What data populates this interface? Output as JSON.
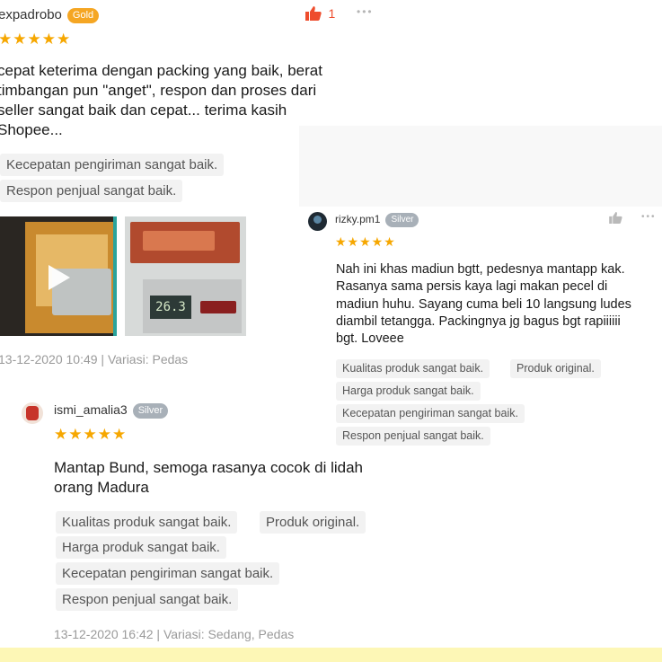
{
  "review1": {
    "username": "expadrobo",
    "badge": "Gold",
    "likes": "1",
    "more": "•••",
    "stars": "★★★★★",
    "text_lines": [
      "cepat keterima dengan packing yang baik, berat",
      "timbangan pun \"anget\", respon dan proses dari",
      "seller sangat baik dan cepat... terima kasih",
      "Shopee..."
    ],
    "tags": [
      "Kecepatan pengiriman sangat baik.",
      "Respon penjual sangat baik."
    ],
    "scale_display": "26.3",
    "meta": "13-12-2020 10:49 | Variasi: Pedas"
  },
  "review2": {
    "username": "rizky.pm1",
    "badge": "Silver",
    "more": "•••",
    "stars": "★★★★★",
    "text_lines": [
      "Nah ini khas madiun bgtt, pedesnya mantapp kak.",
      "Rasanya sama persis kaya lagi makan pecel di",
      "madiun huhu. Sayang cuma beli 10 langsung ludes",
      "diambil tetangga. Packingnya jg bagus bgt rapiiiiii",
      "bgt. Loveee"
    ],
    "tags": [
      "Kualitas produk sangat baik.",
      "Produk original.",
      "Harga produk sangat baik.",
      "Kecepatan pengiriman sangat baik.",
      "Respon penjual sangat baik."
    ]
  },
  "review3": {
    "username": "ismi_amalia3",
    "badge": "Silver",
    "stars": "★★★★★",
    "text_lines": [
      "Mantap Bund, semoga rasanya cocok di lidah",
      "orang Madura"
    ],
    "tags": [
      "Kualitas produk sangat baik.",
      "Produk original.",
      "Harga produk sangat baik.",
      "Kecepatan pengiriman sangat baik.",
      "Respon penjual sangat baik."
    ],
    "meta": "13-12-2020 16:42 | Variasi: Sedang, Pedas"
  },
  "colors": {
    "gold_badge": "#f5a623",
    "silver_badge": "#a8b0b8",
    "star": "#f6a700",
    "like_active": "#ee4d2d",
    "bottom_strip": "#fdf7b6"
  }
}
